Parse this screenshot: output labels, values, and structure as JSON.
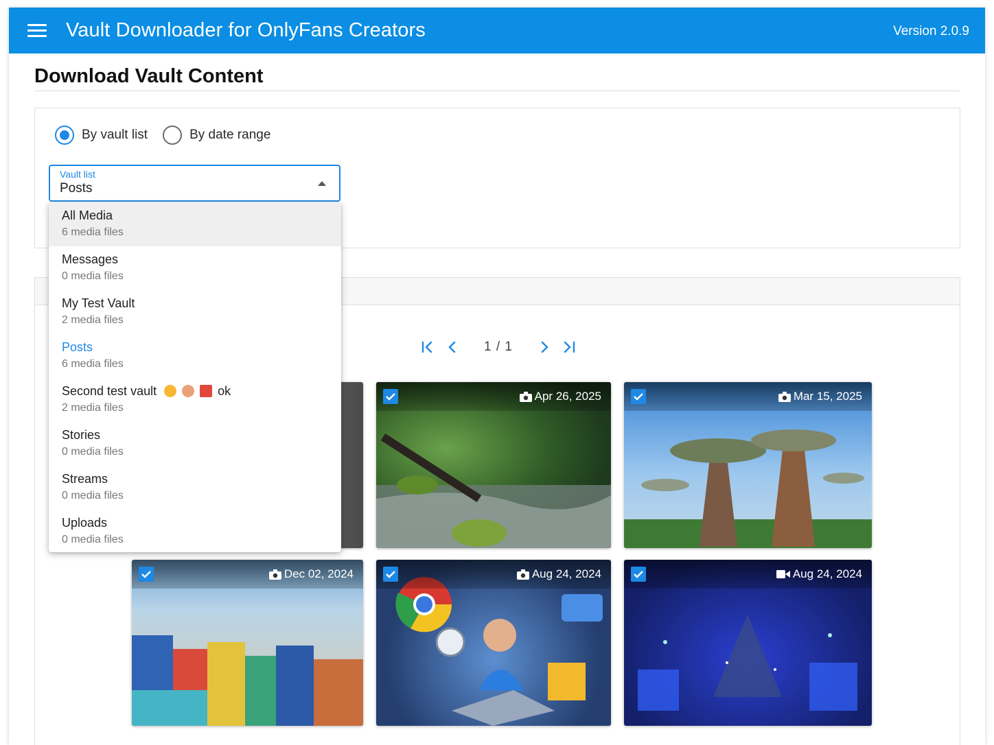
{
  "app": {
    "title": "Vault Downloader for OnlyFans Creators",
    "version": "Version 2.0.9"
  },
  "page": {
    "title": "Download Vault Content"
  },
  "mode": {
    "options": [
      {
        "label": "By vault list",
        "checked": true
      },
      {
        "label": "By date range",
        "checked": false
      }
    ]
  },
  "vault_select": {
    "label": "Vault list",
    "value": "Posts",
    "options": [
      {
        "name": "All Media",
        "count": "6 media files"
      },
      {
        "name": "Messages",
        "count": "0 media files"
      },
      {
        "name": "My Test Vault",
        "count": "2 media files"
      },
      {
        "name": "Posts",
        "count": "6 media files"
      },
      {
        "name": "Second test vault",
        "suffix": "ok",
        "count": "2 media files"
      },
      {
        "name": "Stories",
        "count": "0 media files"
      },
      {
        "name": "Streams",
        "count": "0 media files"
      },
      {
        "name": "Uploads",
        "count": "0 media files"
      }
    ]
  },
  "pagination": {
    "text": "1 / 1"
  },
  "media": [
    {
      "date": "Apr 26, 2025",
      "type": "photo-icon"
    },
    {
      "date": "Mar 15, 2025",
      "type": "photo-icon"
    },
    {
      "date": "Dec 02, 2024",
      "type": "photo-icon"
    },
    {
      "date": "Aug 24, 2024",
      "type": "photo-icon"
    },
    {
      "date": "Aug 24, 2024",
      "type": "video-icon"
    }
  ],
  "colors": {
    "appbar": "#0b8ee3",
    "accent": "#1e88e5"
  }
}
